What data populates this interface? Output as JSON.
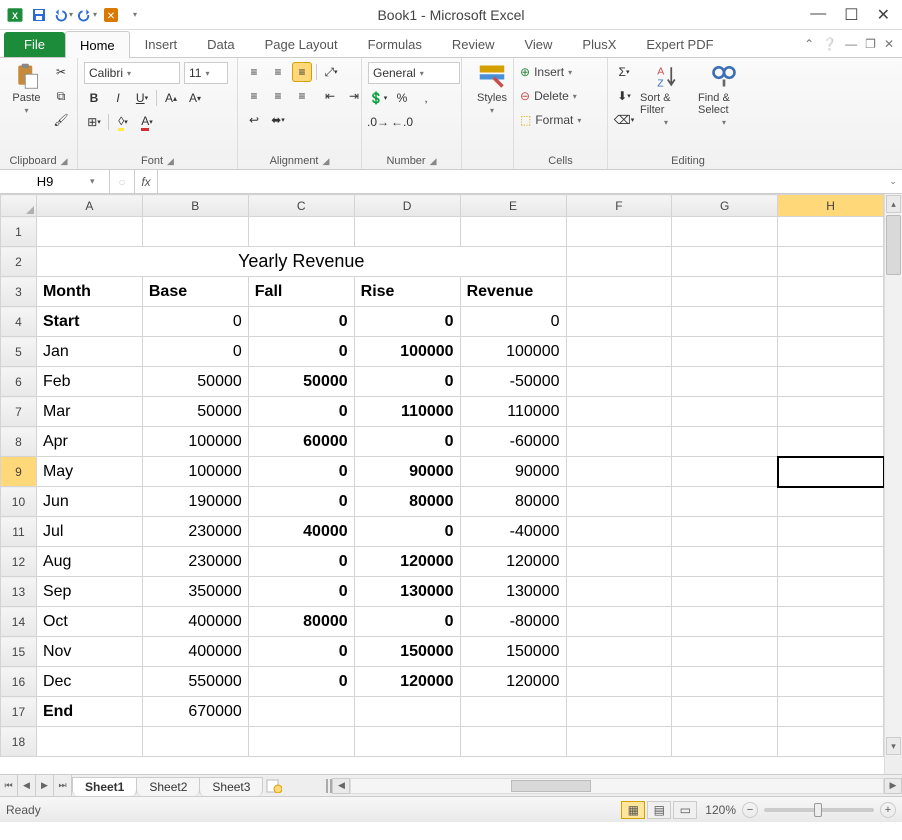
{
  "window": {
    "title": "Book1 - Microsoft Excel"
  },
  "qat": {
    "save": "save",
    "undo": "undo",
    "redo": "redo"
  },
  "tabs": {
    "file": "File",
    "items": [
      "Home",
      "Insert",
      "Data",
      "Page Layout",
      "Formulas",
      "Review",
      "View",
      "PlusX",
      "Expert PDF"
    ],
    "active": "Home"
  },
  "ribbon": {
    "clipboard": {
      "paste": "Paste",
      "label": "Clipboard"
    },
    "font": {
      "name": "Calibri",
      "size": "11",
      "label": "Font"
    },
    "alignment": {
      "label": "Alignment"
    },
    "number": {
      "format": "General",
      "label": "Number"
    },
    "styles": {
      "label": "Styles"
    },
    "cells": {
      "insert": "Insert",
      "delete": "Delete",
      "format": "Format",
      "label": "Cells"
    },
    "editing": {
      "sort": "Sort & Filter",
      "find": "Find & Select",
      "label": "Editing"
    }
  },
  "formula_bar": {
    "name_box": "H9",
    "formula": ""
  },
  "grid": {
    "columns": [
      "A",
      "B",
      "C",
      "D",
      "E",
      "F",
      "G",
      "H"
    ],
    "selected_col": "H",
    "selected_row": 9,
    "row_count": 18,
    "title_cell": "Yearly Revenue",
    "headers": [
      "Month",
      "Base",
      "Fall",
      "Rise",
      "Revenue"
    ],
    "rows": [
      {
        "m": "Start",
        "b": "0",
        "f": "0",
        "r": "0",
        "rev": "0",
        "bold": true
      },
      {
        "m": "Jan",
        "b": "0",
        "f": "0",
        "r": "100000",
        "rev": "100000"
      },
      {
        "m": "Feb",
        "b": "50000",
        "f": "50000",
        "r": "0",
        "rev": "-50000"
      },
      {
        "m": "Mar",
        "b": "50000",
        "f": "0",
        "r": "110000",
        "rev": "110000"
      },
      {
        "m": "Apr",
        "b": "100000",
        "f": "60000",
        "r": "0",
        "rev": "-60000"
      },
      {
        "m": "May",
        "b": "100000",
        "f": "0",
        "r": "90000",
        "rev": "90000"
      },
      {
        "m": "Jun",
        "b": "190000",
        "f": "0",
        "r": "80000",
        "rev": "80000"
      },
      {
        "m": "Jul",
        "b": "230000",
        "f": "40000",
        "r": "0",
        "rev": "-40000"
      },
      {
        "m": "Aug",
        "b": "230000",
        "f": "0",
        "r": "120000",
        "rev": "120000"
      },
      {
        "m": "Sep",
        "b": "350000",
        "f": "0",
        "r": "130000",
        "rev": "130000"
      },
      {
        "m": "Oct",
        "b": "400000",
        "f": "80000",
        "r": "0",
        "rev": "-80000"
      },
      {
        "m": "Nov",
        "b": "400000",
        "f": "0",
        "r": "150000",
        "rev": "150000"
      },
      {
        "m": "Dec",
        "b": "550000",
        "f": "0",
        "r": "120000",
        "rev": "120000"
      },
      {
        "m": "End",
        "b": "670000",
        "f": "",
        "r": "",
        "rev": "",
        "bold": true
      }
    ]
  },
  "sheets": {
    "items": [
      "Sheet1",
      "Sheet2",
      "Sheet3"
    ],
    "active": "Sheet1"
  },
  "status": {
    "text": "Ready",
    "zoom": "120%"
  },
  "chart_data": {
    "type": "table",
    "title": "Yearly Revenue",
    "columns": [
      "Month",
      "Base",
      "Fall",
      "Rise",
      "Revenue"
    ],
    "data": [
      [
        "Start",
        0,
        0,
        0,
        0
      ],
      [
        "Jan",
        0,
        0,
        100000,
        100000
      ],
      [
        "Feb",
        50000,
        50000,
        0,
        -50000
      ],
      [
        "Mar",
        50000,
        0,
        110000,
        110000
      ],
      [
        "Apr",
        100000,
        60000,
        0,
        -60000
      ],
      [
        "May",
        100000,
        0,
        90000,
        90000
      ],
      [
        "Jun",
        190000,
        0,
        80000,
        80000
      ],
      [
        "Jul",
        230000,
        40000,
        0,
        -40000
      ],
      [
        "Aug",
        230000,
        0,
        120000,
        120000
      ],
      [
        "Sep",
        350000,
        0,
        130000,
        130000
      ],
      [
        "Oct",
        400000,
        80000,
        0,
        -80000
      ],
      [
        "Nov",
        400000,
        0,
        150000,
        150000
      ],
      [
        "Dec",
        550000,
        0,
        120000,
        120000
      ],
      [
        "End",
        670000,
        null,
        null,
        null
      ]
    ]
  }
}
